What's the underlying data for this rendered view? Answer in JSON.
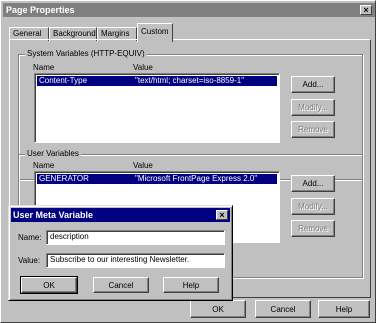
{
  "window": {
    "title": "Page Properties",
    "close_glyph": "×"
  },
  "tabs": [
    {
      "label": "General"
    },
    {
      "label": "Background"
    },
    {
      "label": "Margins"
    },
    {
      "label": "Custom"
    }
  ],
  "system_variables": {
    "legend": "System Variables (HTTP-EQUIV)",
    "col_name": "Name",
    "col_value": "Value",
    "rows": [
      {
        "name": "Content-Type",
        "value": "\"text/html; charset=iso-8859-1\""
      }
    ],
    "add_label": "Add...",
    "modify_label": "Modify...",
    "remove_label": "Remove"
  },
  "user_variables": {
    "legend": "User Variables",
    "col_name": "Name",
    "col_value": "Value",
    "rows": [
      {
        "name": "GENERATOR",
        "value": "\"Microsoft FrontPage Express 2.0\""
      }
    ],
    "add_label": "Add...",
    "modify_label": "Modify...",
    "remove_label": "Remove"
  },
  "footer": {
    "ok_label": "OK",
    "cancel_label": "Cancel",
    "help_label": "Help"
  },
  "dialog": {
    "title": "User Meta Variable",
    "close_glyph": "×",
    "name_label": "Name:",
    "name_value": "description",
    "value_label": "Value:",
    "value_value": "Subscribe to our interesting Newsletter.",
    "ok_label": "OK",
    "cancel_label": "Cancel",
    "help_label": "Help"
  },
  "colors": {
    "face": "#c0c0c0",
    "selection": "#000080",
    "inactive_title": "#808080",
    "active_title": "#000080"
  }
}
